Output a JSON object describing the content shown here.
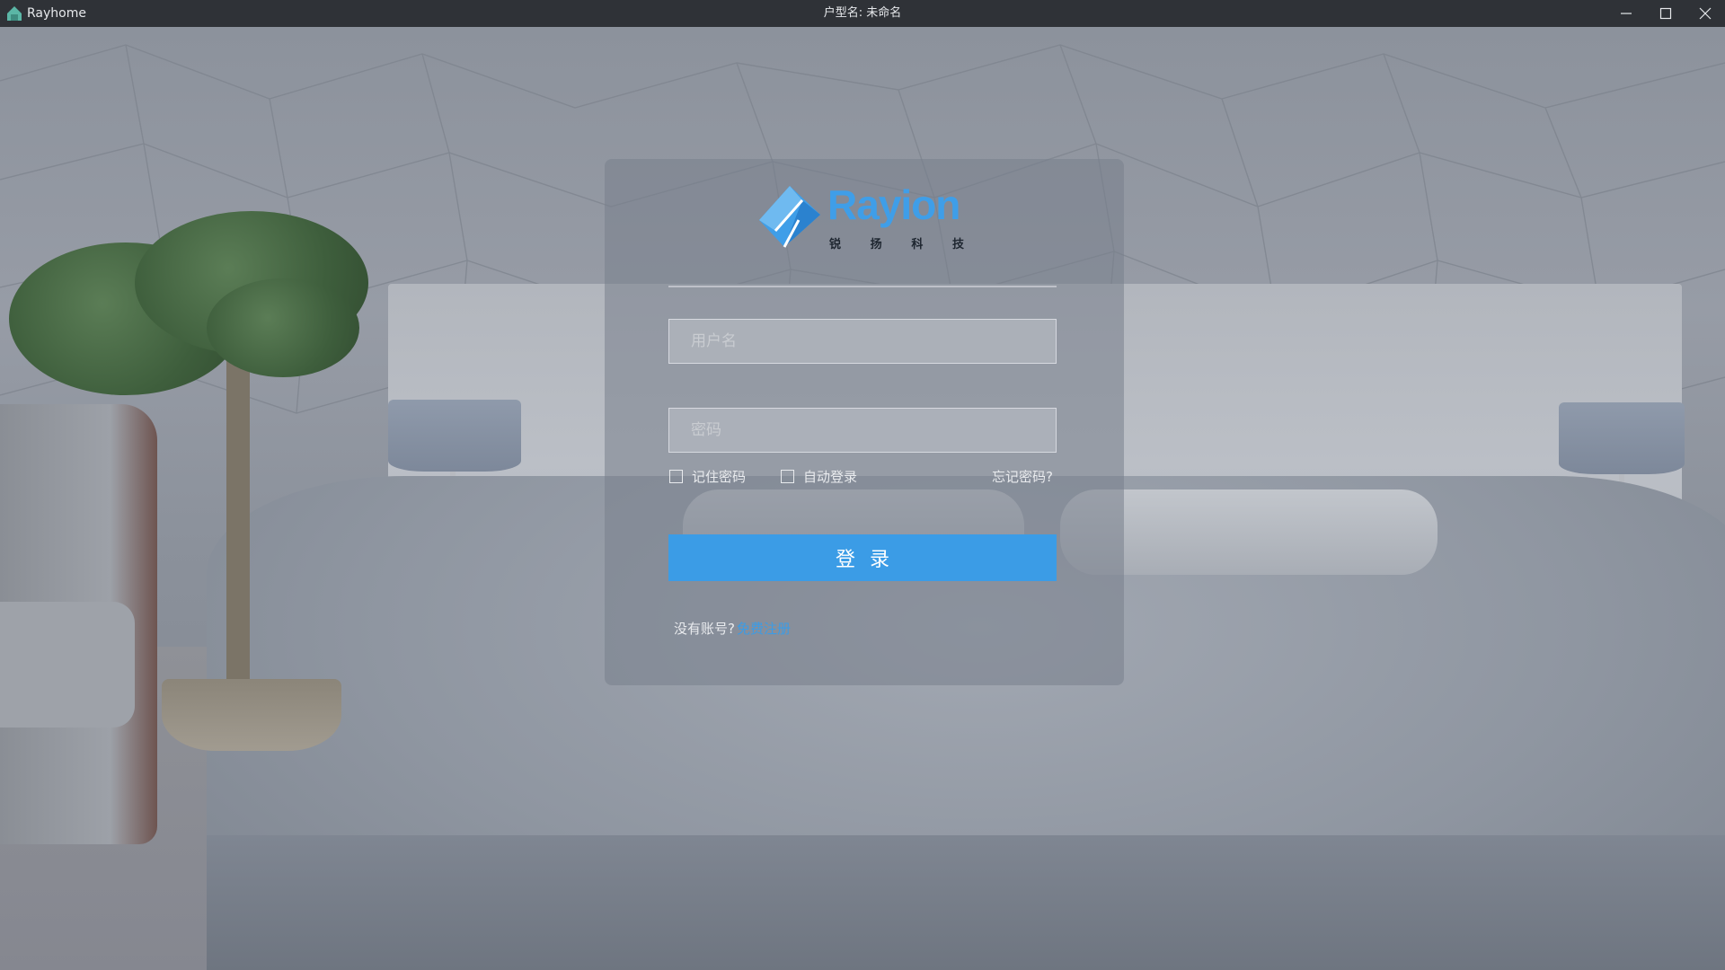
{
  "window": {
    "app_name": "Rayhome",
    "title": "户型名: 未命名",
    "app_icon": "house-icon",
    "controls": [
      "minimize-icon",
      "maximize-icon",
      "close-icon"
    ]
  },
  "logo": {
    "brand": "Rayion",
    "subtitle": [
      "锐",
      "扬",
      "科",
      "技"
    ],
    "brand_color": "#3f9ee8"
  },
  "login": {
    "username_placeholder": "用户名",
    "password_placeholder": "密码",
    "remember_password_label": "记住密码",
    "remember_password_checked": false,
    "auto_login_label": "自动登录",
    "auto_login_checked": false,
    "forgot_password_label": "忘记密码?",
    "login_button_label": "登录",
    "no_account_text": "没有账号?",
    "register_link_label": "免费注册",
    "accent_color": "#3b9ce6"
  }
}
